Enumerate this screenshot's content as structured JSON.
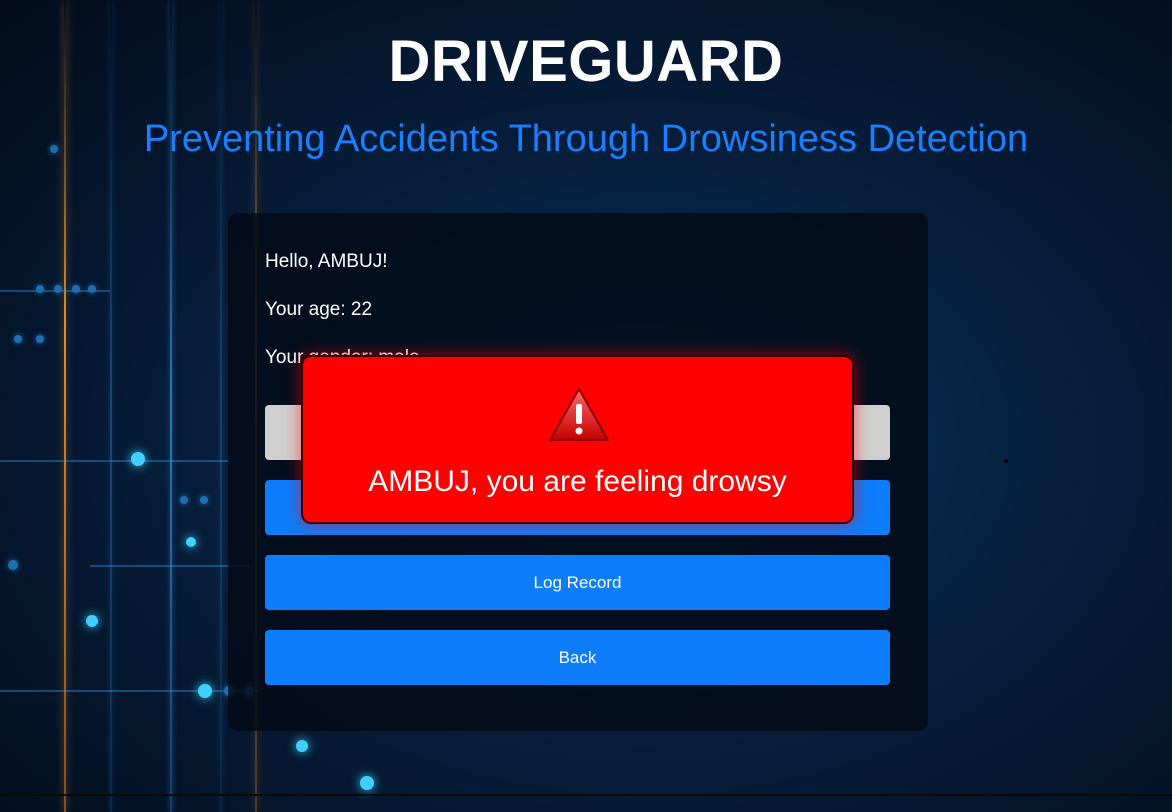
{
  "header": {
    "title": "DRIVEGUARD",
    "subtitle": "Preventing Accidents Through Drowsiness Detection"
  },
  "user_info": {
    "greeting": "Hello, AMBUJ!",
    "age": "Your age: 22",
    "gender": "Your gender: male"
  },
  "buttons": {
    "hidden_top_label": "",
    "hidden_blue_label": "",
    "log_record": "Log Record",
    "back": "Back"
  },
  "alert": {
    "icon": "warning-icon",
    "message": "AMBUJ, you are feeling drowsy"
  },
  "colors": {
    "accent": "#0d7dfb",
    "subtitle": "#1a7fff",
    "alert": "#ff0000"
  }
}
